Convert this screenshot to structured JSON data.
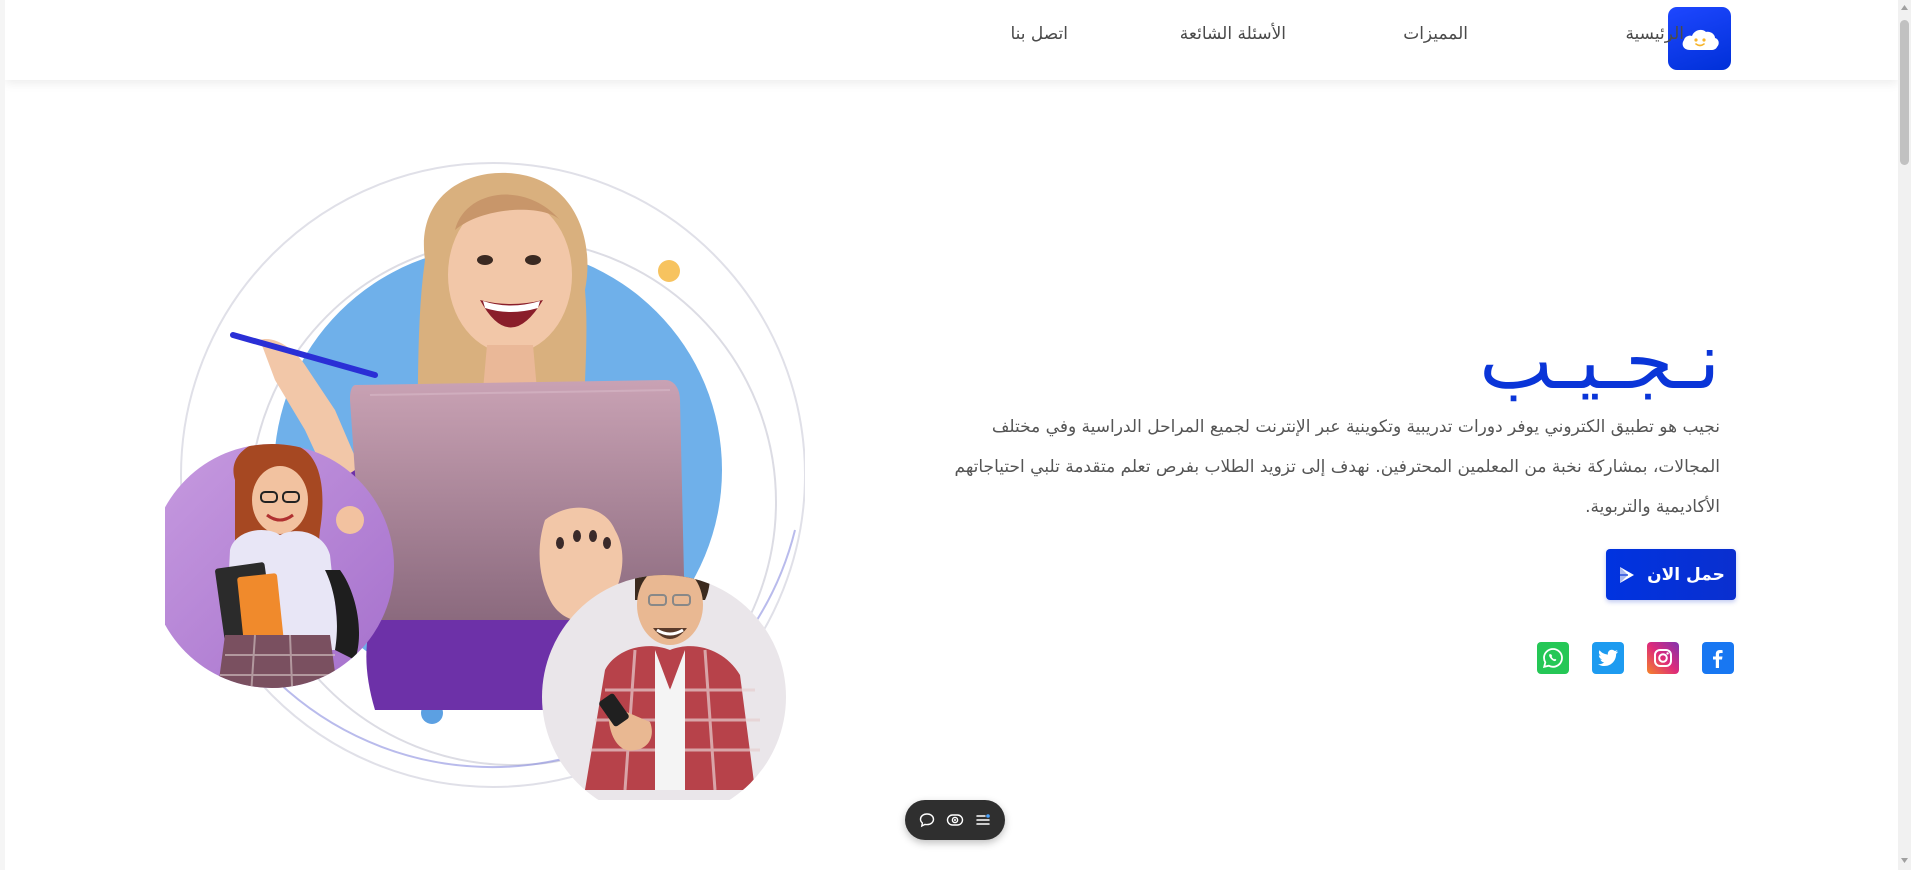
{
  "nav": {
    "home": "الرئيسية",
    "features": "المميزات",
    "faq": "الأسئلة الشائعة",
    "contact": "اتصل بنا"
  },
  "hero": {
    "title": "نـجـيـب",
    "description": "نجيب هو تطبيق الكتروني يوفر دورات تدريبية وتكوينية عبر الإنترنت لجميع المراحل الدراسية وفي مختلف المجالات، بمشاركة نخبة من المعلمين المحترفين. نهدف إلى تزويد الطلاب بفرص تعلم متقدمة تلبي احتياجاتهم الأكاديمية والتربوية.",
    "download_label": "حمل الان"
  },
  "social": [
    {
      "name": "facebook-icon",
      "color": "#1877f2"
    },
    {
      "name": "instagram-icon",
      "color": "#c13584"
    },
    {
      "name": "twitter-icon",
      "color": "#1d9bf0"
    },
    {
      "name": "whatsapp-icon",
      "color": "#25c756"
    }
  ],
  "colors": {
    "primary": "#0a35d8",
    "accent_blue": "#6fb0ea",
    "accent_orange": "#f7c35f",
    "text": "#555555"
  }
}
